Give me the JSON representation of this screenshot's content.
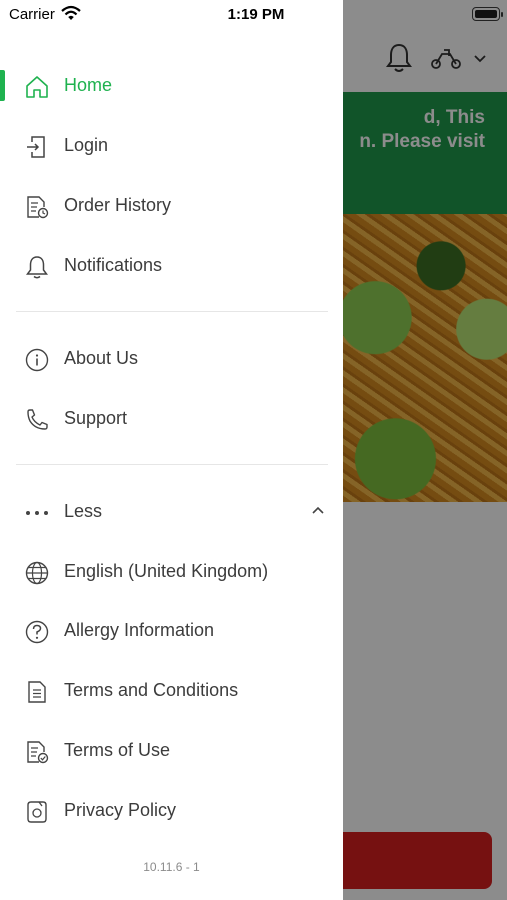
{
  "status_bar": {
    "carrier": "Carrier",
    "time": "1:19 PM"
  },
  "background": {
    "banner_text": "d, This\nn. Please visit\n",
    "colors": {
      "banner": "#1f9a4b",
      "cta": "#d8201f"
    }
  },
  "drawer": {
    "items_main": [
      {
        "label": "Home",
        "icon": "home-icon",
        "active": true
      },
      {
        "label": "Login",
        "icon": "login-icon"
      },
      {
        "label": "Order History",
        "icon": "order-history-icon"
      },
      {
        "label": "Notifications",
        "icon": "bell-icon"
      }
    ],
    "items_info": [
      {
        "label": "About Us",
        "icon": "info-icon"
      },
      {
        "label": "Support",
        "icon": "phone-icon"
      }
    ],
    "items_more": [
      {
        "label": "Less",
        "icon": "more-dots-icon"
      },
      {
        "label": "English (United Kingdom)",
        "icon": "globe-icon"
      },
      {
        "label": "Allergy Information",
        "icon": "question-icon"
      },
      {
        "label": "Terms and Conditions",
        "icon": "document-icon"
      },
      {
        "label": "Terms of Use",
        "icon": "document-check-icon"
      },
      {
        "label": "Privacy Policy",
        "icon": "privacy-icon"
      }
    ],
    "version": "10.11.6 - 1",
    "accent_color": "#1fb24f"
  }
}
